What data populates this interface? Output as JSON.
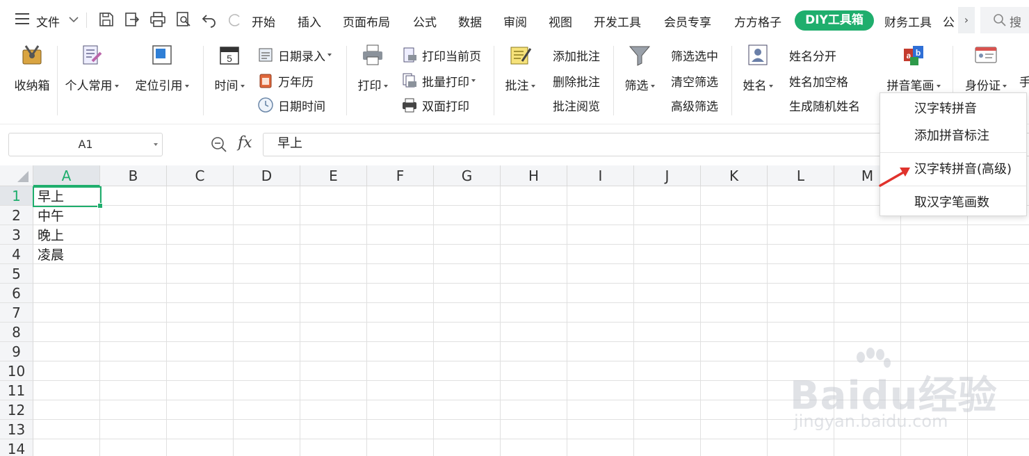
{
  "menu": {
    "file": "文件",
    "tabs": [
      "开始",
      "插入",
      "页面布局",
      "公式",
      "数据",
      "审阅",
      "视图",
      "开发工具",
      "会员专享",
      "方方格子"
    ],
    "active_tab": "DIY工具箱",
    "after_tabs": [
      "财务工具",
      "公"
    ],
    "search_text": "搜"
  },
  "ribbon": {
    "toolbox": "收纳箱",
    "personal": "个人常用",
    "locate": "定位引用",
    "time": "时间",
    "date_entry": "日期录入",
    "calendar": "万年历",
    "datetime": "日期时间",
    "print": "打印",
    "print_current": "打印当前页",
    "batch_print": "批量打印",
    "duplex_print": "双面打印",
    "comment": "批注",
    "add_comment": "添加批注",
    "delete_comment": "删除批注",
    "view_comment": "批注阅览",
    "filter": "筛选",
    "filter_selected": "筛选选中",
    "clear_filter": "清空筛选",
    "advanced_filter": "高级筛选",
    "name": "姓名",
    "split_name": "姓名分开",
    "name_space": "姓名加空格",
    "random_name": "生成随机姓名",
    "pinyin_stroke": "拼音笔画",
    "id_card": "身份证",
    "more": "手"
  },
  "formula_bar": {
    "cell_ref": "A1",
    "fx": "fx",
    "value": "早上"
  },
  "grid": {
    "columns": [
      "A",
      "B",
      "C",
      "D",
      "E",
      "F",
      "G",
      "H",
      "I",
      "J",
      "K",
      "L",
      "M"
    ],
    "rows": [
      "1",
      "2",
      "3",
      "4",
      "5",
      "6",
      "7",
      "8",
      "9",
      "10",
      "11",
      "12",
      "13",
      "14"
    ],
    "cells": [
      "早上",
      "中午",
      "晚上",
      "凌晨"
    ]
  },
  "dropdown": {
    "items": [
      "汉字转拼音",
      "添加拼音标注",
      "汉字转拼音(高级)",
      "取汉字笔画数"
    ]
  },
  "watermark": {
    "main": "Baidu经验",
    "sub": "jingyan.baidu.com"
  },
  "colors": {
    "accent": "#1fae6d",
    "arrow": "#e0322c"
  }
}
